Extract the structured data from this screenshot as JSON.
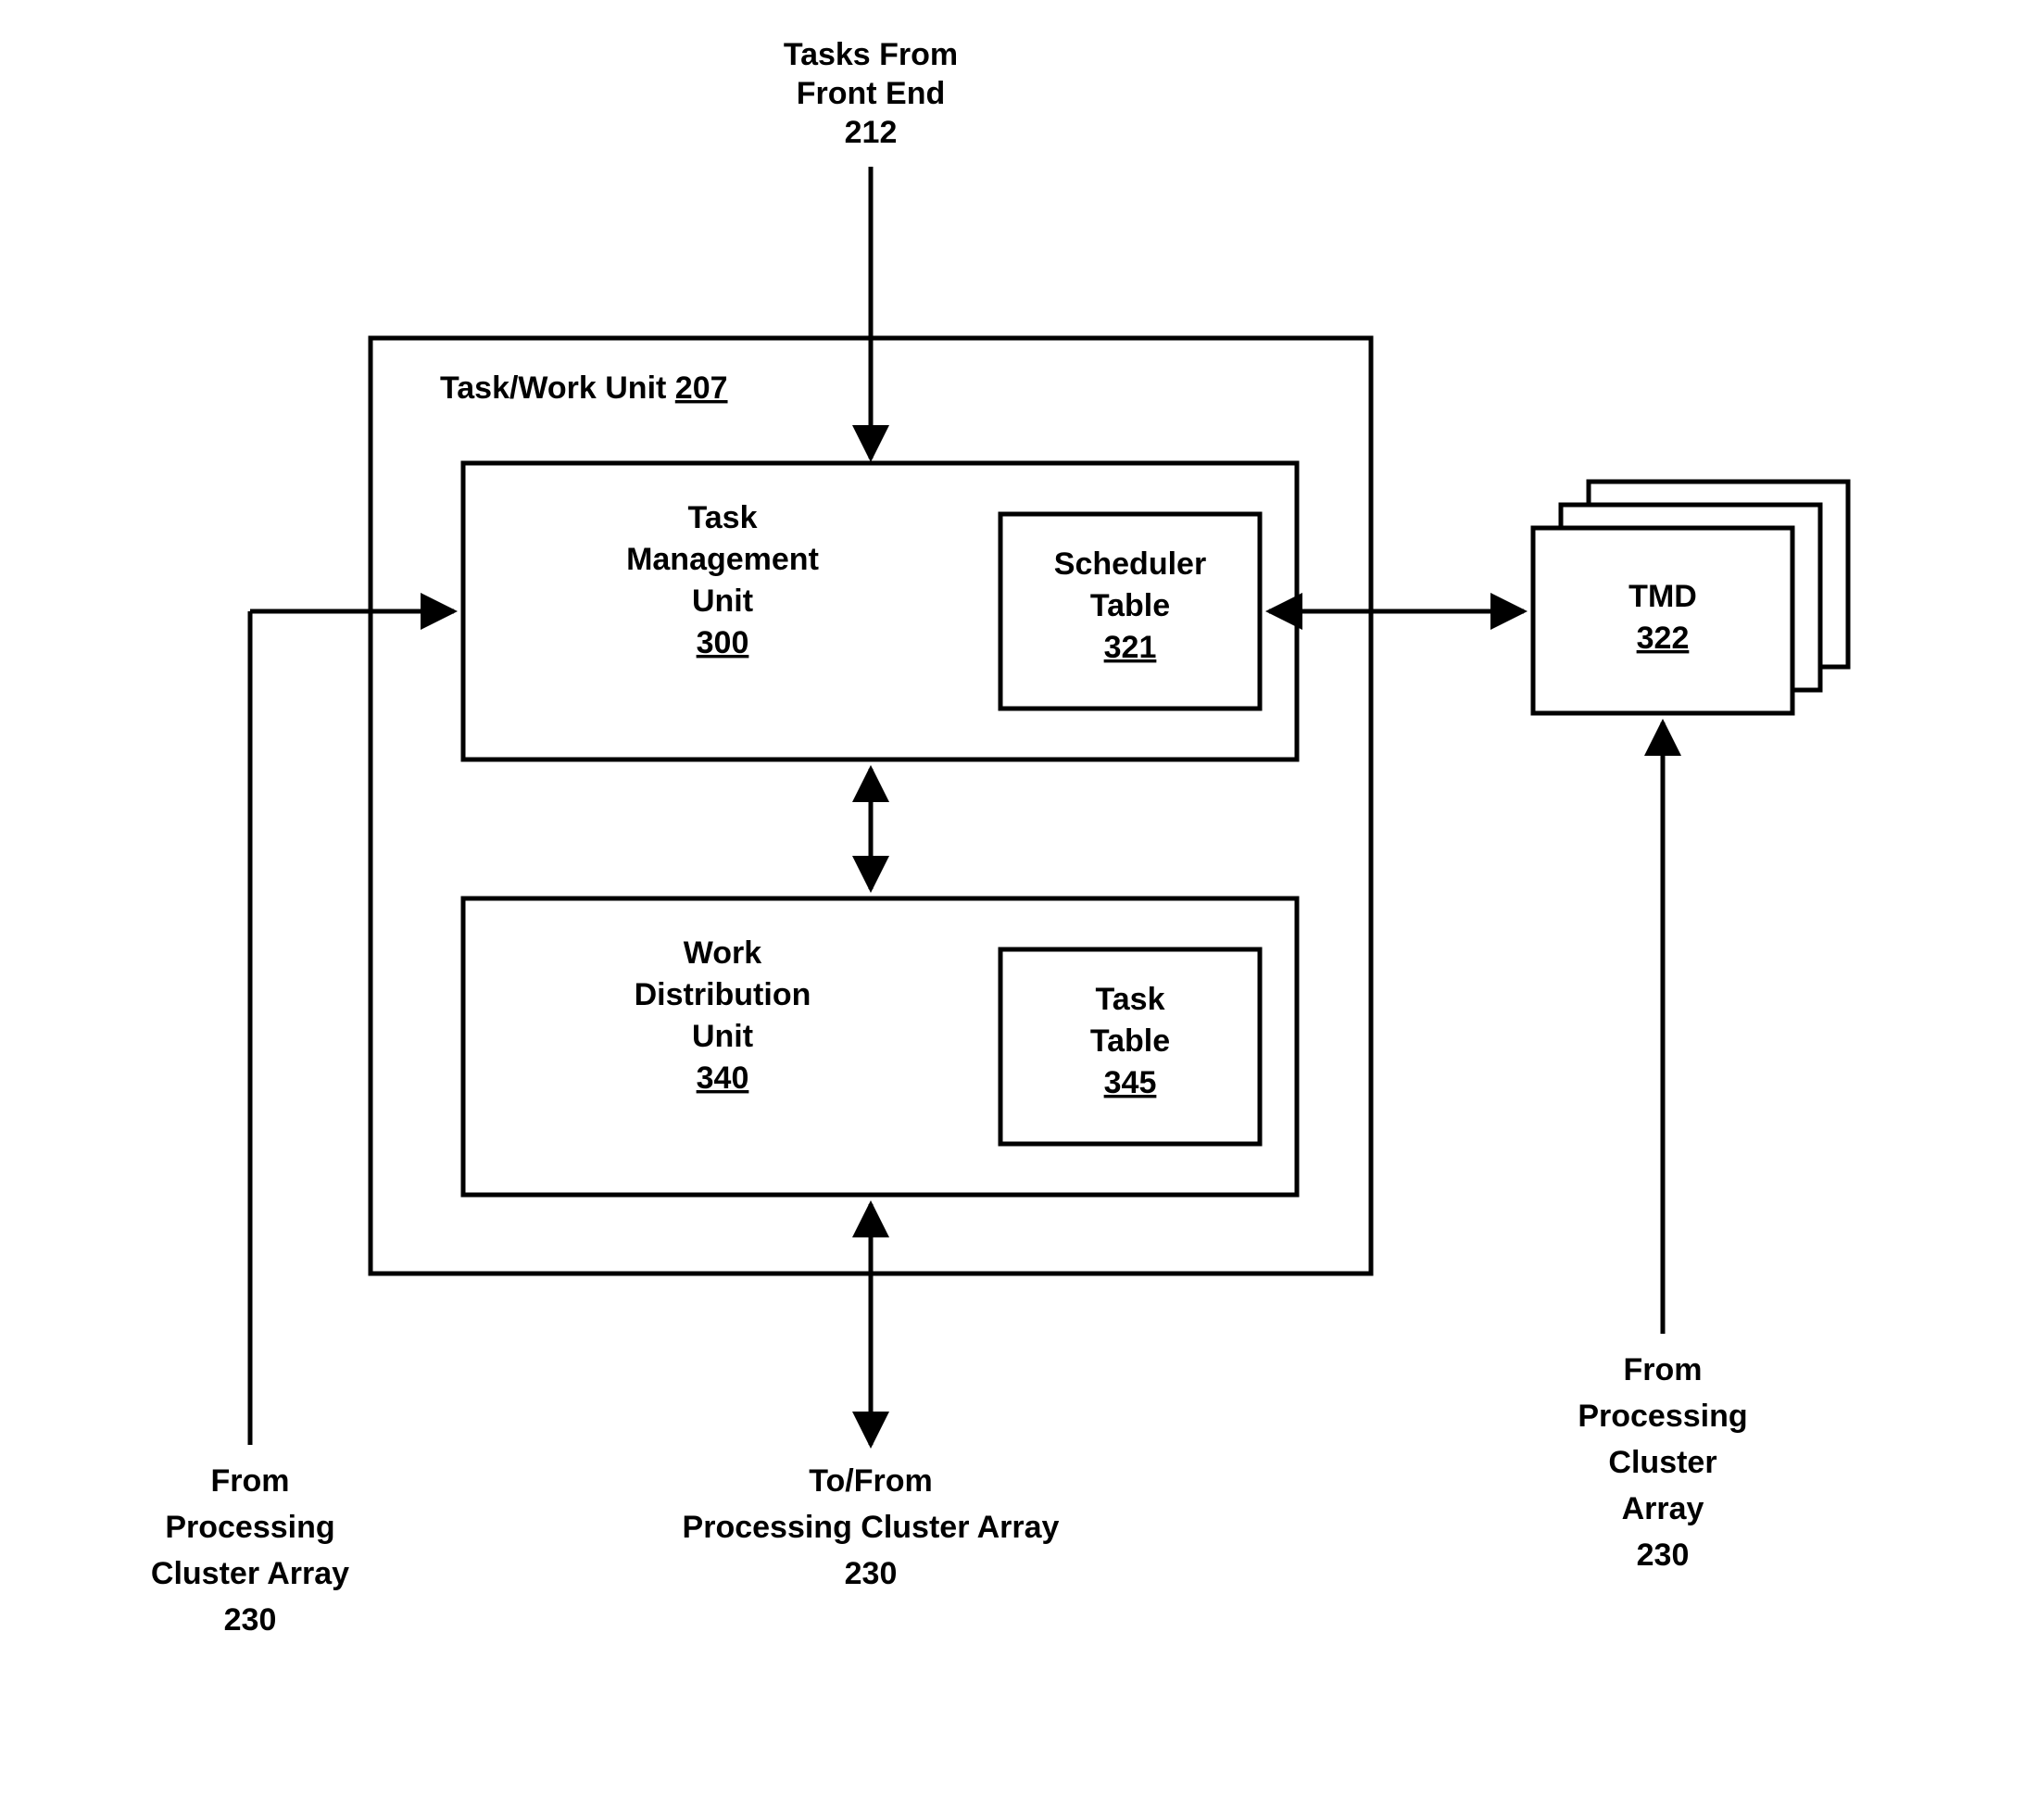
{
  "top_label": {
    "line1": "Tasks From",
    "line2": "Front End",
    "num": "212"
  },
  "task_work_unit": {
    "label": "Task/Work Unit",
    "num": "207"
  },
  "tm_unit": {
    "line1": "Task",
    "line2": "Management",
    "line3": "Unit",
    "num": "300"
  },
  "scheduler_table": {
    "line1": "Scheduler",
    "line2": "Table",
    "num": "321"
  },
  "wd_unit": {
    "line1": "Work",
    "line2": "Distribution",
    "line3": "Unit",
    "num": "340"
  },
  "task_table": {
    "line1": "Task",
    "line2": "Table",
    "num": "345"
  },
  "tmd": {
    "label": "TMD",
    "num": "322"
  },
  "left_bottom": {
    "line1": "From",
    "line2": "Processing",
    "line3": "Cluster Array",
    "num": "230"
  },
  "center_bottom": {
    "line1": "To/From",
    "line2": "Processing Cluster Array",
    "num": "230"
  },
  "right_bottom": {
    "line1": "From",
    "line2": "Processing",
    "line3": "Cluster",
    "line4": "Array",
    "num": "230"
  }
}
